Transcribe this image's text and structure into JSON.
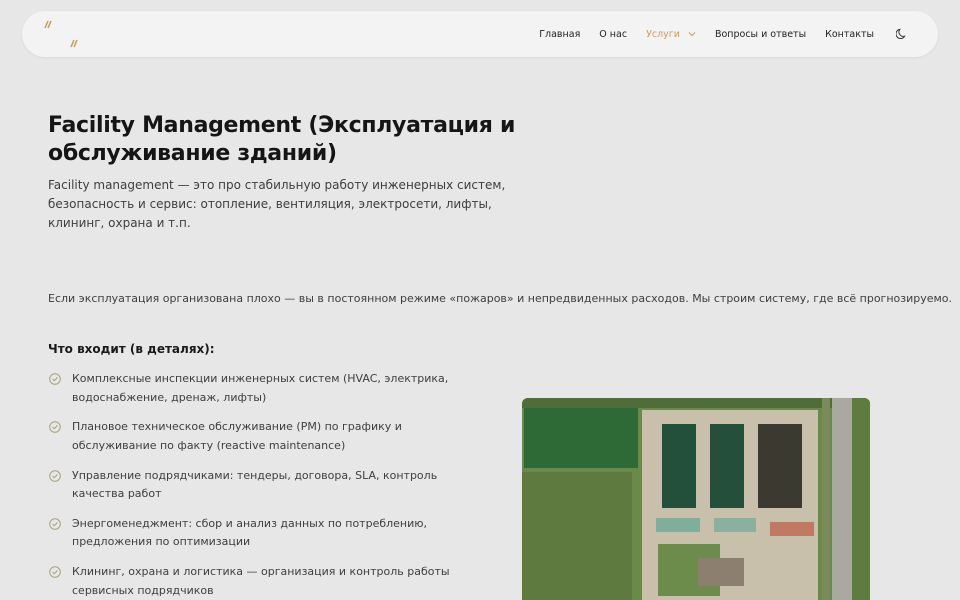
{
  "logo": {
    "text": "NI BL"
  },
  "nav": {
    "items": [
      {
        "label": "Главная"
      },
      {
        "label": "О нас"
      },
      {
        "label": "Услуги"
      },
      {
        "label": "Вопросы и ответы"
      },
      {
        "label": "Контакты"
      }
    ],
    "active_index": 2,
    "theme_icon": "moon-icon"
  },
  "hero": {
    "title": "Facility Management (Эксплуатация и обслуживание зданий)",
    "lead": "Facility management — это про стабильную работу инженерных систем, безопасность и сервис: отопление, вентиляция, электросети, лифты, клининг, охрана и т.п."
  },
  "intro": "Если эксплуатация организована плохо — вы в постоянном режиме «пожаров» и непредвиденных расходов. Мы строим систему, где всё прогнозируемо.",
  "details": {
    "heading": "Что входит (в деталях):",
    "items": [
      "Комплексные инспекции инженерных систем (HVAC, электрика, водоснабжение, дренаж, лифты)",
      "Плановое техническое обслуживание (PM) по графику и обслуживание по факту (reactive maintenance)",
      "Управление подрядчиками: тендеры, договора, SLA, контроль качества работ",
      "Энергоменеджмент: сбор и анализ данных по потреблению, предложения по оптимизации",
      "Клининг, охрана и логистика — организация и контроль работы сервисных подрядчиков"
    ]
  },
  "colors": {
    "accent": "#c99a5e",
    "page_bg": "#e7e7e7",
    "nav_bg": "#f3f3f3",
    "text": "#1c1c1c",
    "muted_text": "#3e3e3e",
    "check_icon": "#a5a37c"
  },
  "icons": {
    "list_marker": "check-circle-icon",
    "dropdown": "chevron-down-icon"
  }
}
